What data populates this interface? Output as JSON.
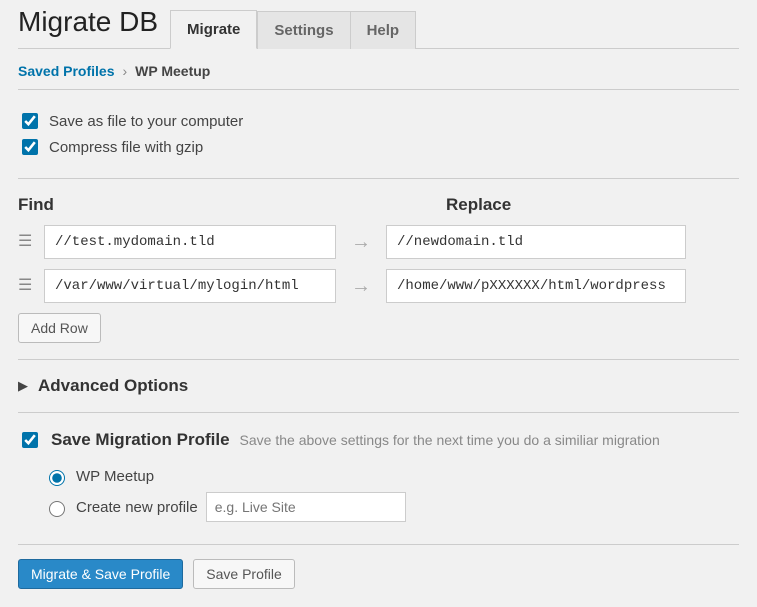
{
  "header": {
    "title": "Migrate DB"
  },
  "tabs": [
    {
      "label": "Migrate",
      "active": true
    },
    {
      "label": "Settings"
    },
    {
      "label": "Help"
    }
  ],
  "breadcrumb": {
    "root": "Saved Profiles",
    "current": "WP Meetup"
  },
  "options": {
    "save_as_file": {
      "label": "Save as file to your computer",
      "checked": true
    },
    "compress_gzip": {
      "label": "Compress file with gzip",
      "checked": true
    }
  },
  "findreplace": {
    "find_header": "Find",
    "replace_header": "Replace",
    "rows": [
      {
        "find": "//test.mydomain.tld",
        "replace": "//newdomain.tld"
      },
      {
        "find": "/var/www/virtual/mylogin/html",
        "replace": "/home/www/pXXXXXX/html/wordpress"
      }
    ],
    "add_row": "Add Row"
  },
  "advanced": {
    "title": "Advanced Options"
  },
  "profile": {
    "title": "Save Migration Profile",
    "desc": "Save the above settings for the next time you do a similiar migration",
    "checked": true,
    "options": {
      "existing": {
        "label": "WP Meetup",
        "selected": true
      },
      "new": {
        "label": "Create new profile",
        "placeholder": "e.g. Live Site",
        "selected": false
      }
    }
  },
  "buttons": {
    "migrate_save": "Migrate & Save Profile",
    "save": "Save Profile"
  }
}
